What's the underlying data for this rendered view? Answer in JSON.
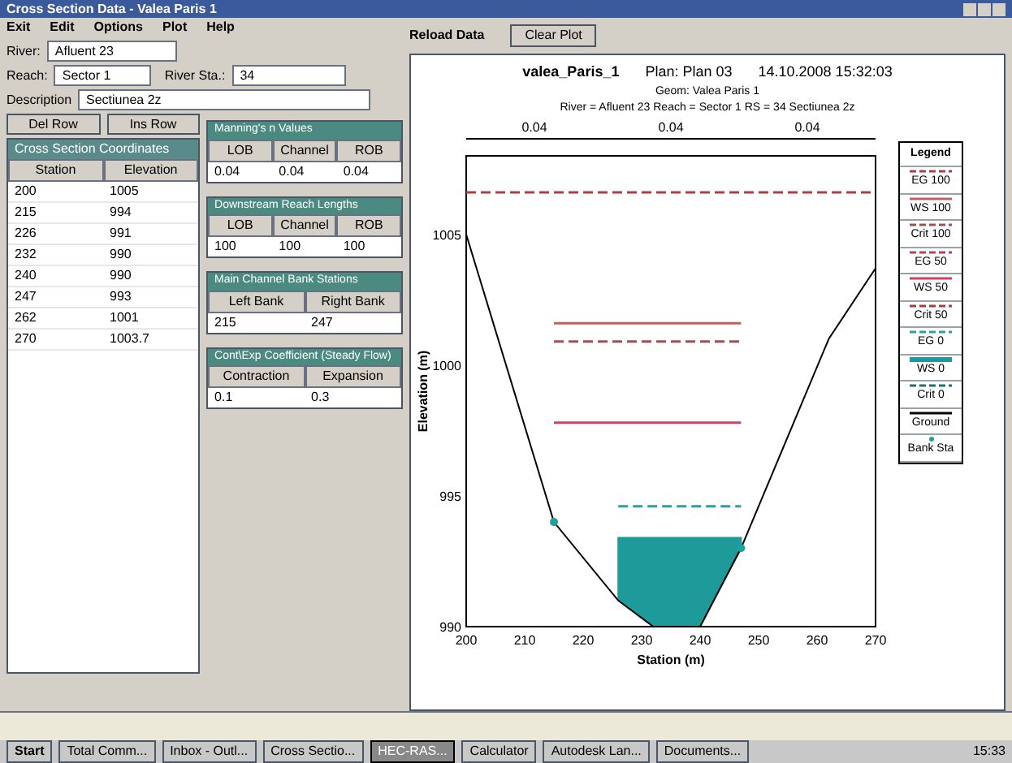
{
  "window": {
    "title": "Cross Section Data - Valea Paris 1"
  },
  "menu": [
    "Exit",
    "Edit",
    "Options",
    "Plot",
    "Help"
  ],
  "fields": {
    "river": {
      "label": "River:",
      "value": "Afluent 23"
    },
    "reach": {
      "label": "Reach:",
      "value": "Sector 1"
    },
    "river_sta": {
      "label": "River Sta.:",
      "value": "34"
    },
    "description": {
      "label": "Description",
      "value": "Sectiunea 2z"
    }
  },
  "row_buttons": [
    "Del Row",
    "Ins Row"
  ],
  "coordinates": {
    "title": "Cross Section Coordinates",
    "columns": [
      "Station",
      "Elevation"
    ],
    "rows": [
      [
        "200",
        "1005"
      ],
      [
        "215",
        "994"
      ],
      [
        "226",
        "991"
      ],
      [
        "232",
        "990"
      ],
      [
        "240",
        "990"
      ],
      [
        "247",
        "993"
      ],
      [
        "262",
        "1001"
      ],
      [
        "270",
        "1003.7"
      ]
    ]
  },
  "small_tables": [
    {
      "title": "Manning's n Values",
      "columns": [
        "LOB",
        "Channel",
        "ROB"
      ],
      "values": [
        "0.04",
        "0.04",
        "0.04"
      ]
    },
    {
      "title": "Downstream Reach Lengths",
      "columns": [
        "LOB",
        "Channel",
        "ROB"
      ],
      "values": [
        "100",
        "100",
        "100"
      ]
    },
    {
      "title": "Main Channel Bank Stations",
      "columns": [
        "Left Bank",
        "Right Bank"
      ],
      "values": [
        "215",
        "247"
      ]
    },
    {
      "title": "Cont\\Exp Coefficient (Steady Flow)",
      "columns": [
        "Contraction",
        "Expansion"
      ],
      "values": [
        "0.1",
        "0.3"
      ]
    }
  ],
  "plot_toolbar": {
    "reload": "Reload Data",
    "clear": "Clear Plot"
  },
  "plot": {
    "title": "valea_Paris_1",
    "plan": "Plan: Plan 03",
    "date": "14.10.2008 15:32:03",
    "geom": "Geom: Valea Paris 1",
    "location": "River = Afluent 23   Reach = Sector 1   RS = 34   Sectiunea 2z",
    "n_values": [
      "0.04",
      "0.04",
      "0.04"
    ],
    "legend_title": "Legend",
    "chart_data": {
      "type": "line",
      "xlabel": "Station (m)",
      "ylabel": "Elevation (m)",
      "x": [
        200,
        215,
        226,
        232,
        240,
        247,
        262,
        270
      ],
      "xlim": [
        200,
        270
      ],
      "ylim": [
        990,
        1008
      ],
      "xticks": [
        200,
        210,
        220,
        230,
        240,
        250,
        260,
        270
      ],
      "yticks": [
        990,
        995,
        1000,
        1005
      ],
      "series": [
        {
          "name": "EG 100",
          "type": "line",
          "line_style": "dashed",
          "color": "#b04040",
          "values": [
            1006.6,
            1006.6,
            1006.6,
            1006.6,
            1006.6,
            1006.6,
            1006.6,
            1006.6
          ]
        },
        {
          "name": "WS 100",
          "type": "line",
          "line_style": "solid",
          "color": "#c06060",
          "values": [
            null,
            1001.6,
            1001.6,
            1001.6,
            1001.6,
            1001.6,
            null,
            null
          ]
        },
        {
          "name": "Crit 100",
          "type": "line",
          "line_style": "dashed",
          "color": "#a05050",
          "values": [
            null,
            1000.9,
            1000.9,
            1000.9,
            1000.9,
            1000.9,
            null,
            null
          ]
        },
        {
          "name": "EG 50",
          "type": "line",
          "line_style": "dashed",
          "color": "#c04050",
          "values": [
            null,
            null,
            null,
            null,
            null,
            null,
            null,
            null
          ]
        },
        {
          "name": "WS 50",
          "type": "line",
          "line_style": "solid",
          "color": "#d04060",
          "values": [
            null,
            997.8,
            997.8,
            997.8,
            997.8,
            997.8,
            null,
            null
          ]
        },
        {
          "name": "Crit 50",
          "type": "line",
          "line_style": "dashed",
          "color": "#a04040",
          "values": [
            null,
            null,
            null,
            null,
            null,
            null,
            null,
            null
          ]
        },
        {
          "name": "EG 0",
          "type": "line",
          "line_style": "dashed",
          "color": "#2aa0a0",
          "values": [
            null,
            null,
            994.6,
            994.6,
            994.6,
            994.6,
            null,
            null
          ]
        },
        {
          "name": "WS 0",
          "type": "area",
          "line_style": "solid",
          "color": "#1f9a9a",
          "values": [
            null,
            null,
            993.4,
            993.4,
            993.4,
            993.4,
            null,
            null
          ]
        },
        {
          "name": "Crit 0",
          "type": "line",
          "line_style": "dashed",
          "color": "#207070",
          "values": [
            null,
            null,
            null,
            null,
            null,
            null,
            null,
            null
          ]
        },
        {
          "name": "Ground",
          "type": "line",
          "line_style": "solid",
          "color": "#000000",
          "values": [
            1005,
            994,
            991,
            990,
            990,
            993,
            1001,
            1003.7
          ]
        },
        {
          "name": "Bank Sta",
          "type": "scatter",
          "line_style": "none",
          "color": "#20a0a0",
          "values": [
            null,
            994,
            null,
            null,
            null,
            993,
            null,
            null
          ]
        }
      ]
    }
  },
  "taskbar": {
    "start": "Start",
    "items": [
      {
        "label": "Total Comm...",
        "selected": false
      },
      {
        "label": "Inbox - Outl...",
        "selected": false
      },
      {
        "label": "Cross Sectio...",
        "selected": false
      },
      {
        "label": "HEC-RAS...",
        "selected": true
      },
      {
        "label": "Calculator",
        "selected": false
      },
      {
        "label": "Autodesk Lan...",
        "selected": false
      },
      {
        "label": "Documents...",
        "selected": false
      }
    ],
    "clock": "15:33"
  }
}
